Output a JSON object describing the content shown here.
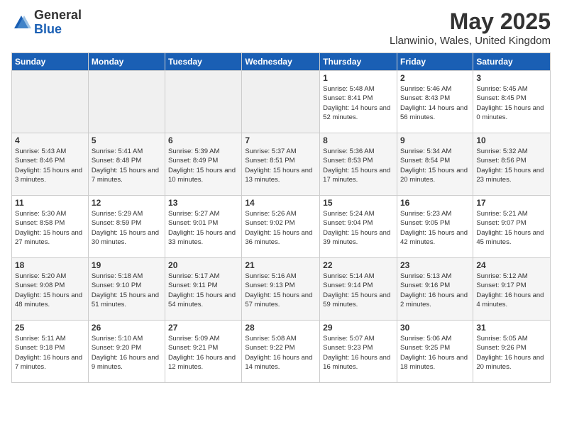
{
  "logo": {
    "general": "General",
    "blue": "Blue"
  },
  "title": "May 2025",
  "location": "Llanwinio, Wales, United Kingdom",
  "weekdays": [
    "Sunday",
    "Monday",
    "Tuesday",
    "Wednesday",
    "Thursday",
    "Friday",
    "Saturday"
  ],
  "weeks": [
    [
      {
        "day": "",
        "info": ""
      },
      {
        "day": "",
        "info": ""
      },
      {
        "day": "",
        "info": ""
      },
      {
        "day": "",
        "info": ""
      },
      {
        "day": "1",
        "info": "Sunrise: 5:48 AM\nSunset: 8:41 PM\nDaylight: 14 hours\nand 52 minutes."
      },
      {
        "day": "2",
        "info": "Sunrise: 5:46 AM\nSunset: 8:43 PM\nDaylight: 14 hours\nand 56 minutes."
      },
      {
        "day": "3",
        "info": "Sunrise: 5:45 AM\nSunset: 8:45 PM\nDaylight: 15 hours\nand 0 minutes."
      }
    ],
    [
      {
        "day": "4",
        "info": "Sunrise: 5:43 AM\nSunset: 8:46 PM\nDaylight: 15 hours\nand 3 minutes."
      },
      {
        "day": "5",
        "info": "Sunrise: 5:41 AM\nSunset: 8:48 PM\nDaylight: 15 hours\nand 7 minutes."
      },
      {
        "day": "6",
        "info": "Sunrise: 5:39 AM\nSunset: 8:49 PM\nDaylight: 15 hours\nand 10 minutes."
      },
      {
        "day": "7",
        "info": "Sunrise: 5:37 AM\nSunset: 8:51 PM\nDaylight: 15 hours\nand 13 minutes."
      },
      {
        "day": "8",
        "info": "Sunrise: 5:36 AM\nSunset: 8:53 PM\nDaylight: 15 hours\nand 17 minutes."
      },
      {
        "day": "9",
        "info": "Sunrise: 5:34 AM\nSunset: 8:54 PM\nDaylight: 15 hours\nand 20 minutes."
      },
      {
        "day": "10",
        "info": "Sunrise: 5:32 AM\nSunset: 8:56 PM\nDaylight: 15 hours\nand 23 minutes."
      }
    ],
    [
      {
        "day": "11",
        "info": "Sunrise: 5:30 AM\nSunset: 8:58 PM\nDaylight: 15 hours\nand 27 minutes."
      },
      {
        "day": "12",
        "info": "Sunrise: 5:29 AM\nSunset: 8:59 PM\nDaylight: 15 hours\nand 30 minutes."
      },
      {
        "day": "13",
        "info": "Sunrise: 5:27 AM\nSunset: 9:01 PM\nDaylight: 15 hours\nand 33 minutes."
      },
      {
        "day": "14",
        "info": "Sunrise: 5:26 AM\nSunset: 9:02 PM\nDaylight: 15 hours\nand 36 minutes."
      },
      {
        "day": "15",
        "info": "Sunrise: 5:24 AM\nSunset: 9:04 PM\nDaylight: 15 hours\nand 39 minutes."
      },
      {
        "day": "16",
        "info": "Sunrise: 5:23 AM\nSunset: 9:05 PM\nDaylight: 15 hours\nand 42 minutes."
      },
      {
        "day": "17",
        "info": "Sunrise: 5:21 AM\nSunset: 9:07 PM\nDaylight: 15 hours\nand 45 minutes."
      }
    ],
    [
      {
        "day": "18",
        "info": "Sunrise: 5:20 AM\nSunset: 9:08 PM\nDaylight: 15 hours\nand 48 minutes."
      },
      {
        "day": "19",
        "info": "Sunrise: 5:18 AM\nSunset: 9:10 PM\nDaylight: 15 hours\nand 51 minutes."
      },
      {
        "day": "20",
        "info": "Sunrise: 5:17 AM\nSunset: 9:11 PM\nDaylight: 15 hours\nand 54 minutes."
      },
      {
        "day": "21",
        "info": "Sunrise: 5:16 AM\nSunset: 9:13 PM\nDaylight: 15 hours\nand 57 minutes."
      },
      {
        "day": "22",
        "info": "Sunrise: 5:14 AM\nSunset: 9:14 PM\nDaylight: 15 hours\nand 59 minutes."
      },
      {
        "day": "23",
        "info": "Sunrise: 5:13 AM\nSunset: 9:16 PM\nDaylight: 16 hours\nand 2 minutes."
      },
      {
        "day": "24",
        "info": "Sunrise: 5:12 AM\nSunset: 9:17 PM\nDaylight: 16 hours\nand 4 minutes."
      }
    ],
    [
      {
        "day": "25",
        "info": "Sunrise: 5:11 AM\nSunset: 9:18 PM\nDaylight: 16 hours\nand 7 minutes."
      },
      {
        "day": "26",
        "info": "Sunrise: 5:10 AM\nSunset: 9:20 PM\nDaylight: 16 hours\nand 9 minutes."
      },
      {
        "day": "27",
        "info": "Sunrise: 5:09 AM\nSunset: 9:21 PM\nDaylight: 16 hours\nand 12 minutes."
      },
      {
        "day": "28",
        "info": "Sunrise: 5:08 AM\nSunset: 9:22 PM\nDaylight: 16 hours\nand 14 minutes."
      },
      {
        "day": "29",
        "info": "Sunrise: 5:07 AM\nSunset: 9:23 PM\nDaylight: 16 hours\nand 16 minutes."
      },
      {
        "day": "30",
        "info": "Sunrise: 5:06 AM\nSunset: 9:25 PM\nDaylight: 16 hours\nand 18 minutes."
      },
      {
        "day": "31",
        "info": "Sunrise: 5:05 AM\nSunset: 9:26 PM\nDaylight: 16 hours\nand 20 minutes."
      }
    ]
  ]
}
